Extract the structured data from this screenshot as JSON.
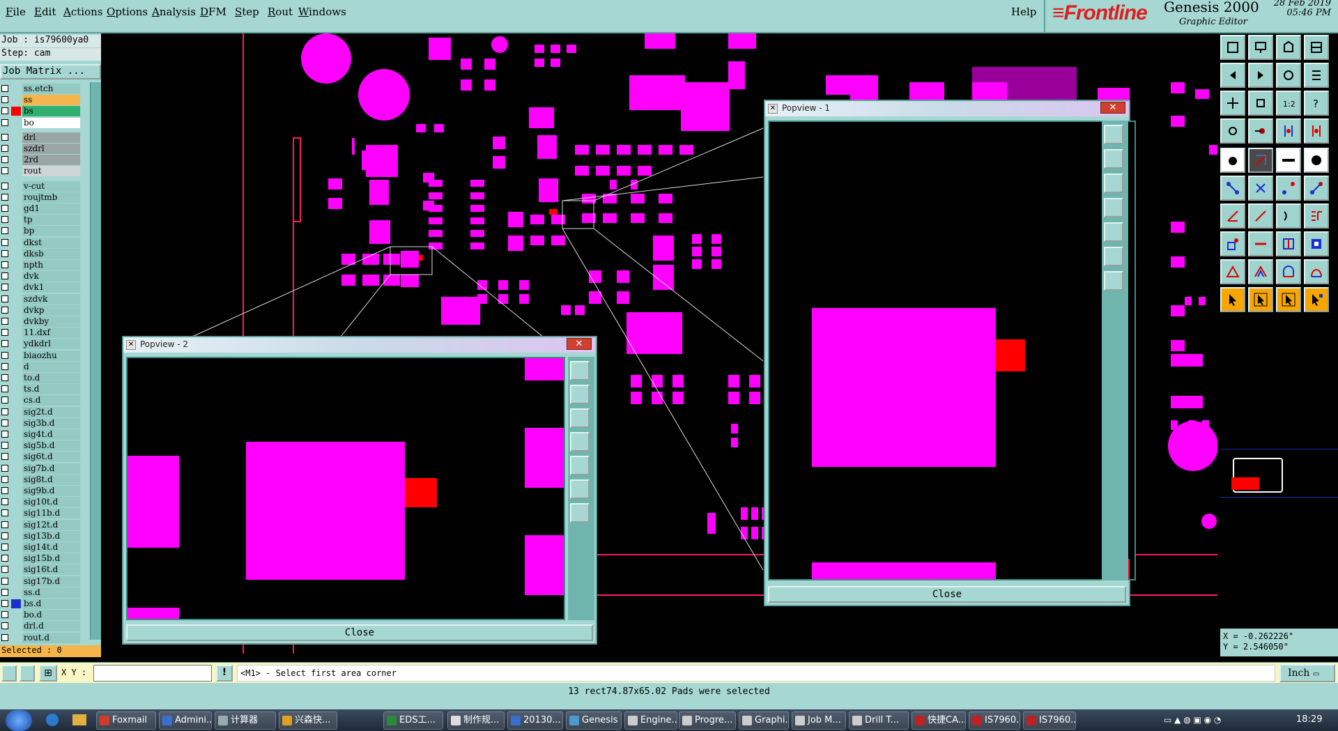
{
  "menu": [
    "File",
    "Edit",
    "Actions",
    "Options",
    "Analysis",
    "DFM",
    "Step",
    "Rout",
    "Windows"
  ],
  "help": "Help",
  "brand": {
    "logo": "Frontline",
    "title": "Genesis 2000",
    "subtitle": "Graphic Editor",
    "date": "28 Feb 2019",
    "time": "05:46 PM"
  },
  "job": {
    "job_line": "Job : is79600ya0",
    "step_line": "Step: cam",
    "job_matrix": "Job Matrix ..."
  },
  "layers": [
    {
      "name": "ss.etch",
      "color": "#94c9c4",
      "swatch": ""
    },
    {
      "name": "ss",
      "color": "#f5b54a",
      "swatch": ""
    },
    {
      "name": "bs",
      "color": "#2fb070",
      "swatch": "#ff0000"
    },
    {
      "name": "bo",
      "color": "#ffffff",
      "swatch": ""
    },
    {
      "name": "drl",
      "color": "#9aa6a4",
      "swatch": ""
    },
    {
      "name": "szdrl",
      "color": "#9aa6a4",
      "swatch": ""
    },
    {
      "name": "2rd",
      "color": "#9aa6a4",
      "swatch": ""
    },
    {
      "name": "rout",
      "color": "#d0d6d5",
      "swatch": ""
    },
    {
      "name": "v-cut",
      "color": "#94c9c4",
      "swatch": ""
    },
    {
      "name": "roujtmb",
      "color": "#94c9c4",
      "swatch": ""
    },
    {
      "name": "gd1",
      "color": "#94c9c4",
      "swatch": ""
    },
    {
      "name": "tp",
      "color": "#94c9c4",
      "swatch": ""
    },
    {
      "name": "bp",
      "color": "#94c9c4",
      "swatch": ""
    },
    {
      "name": "dkst",
      "color": "#94c9c4",
      "swatch": ""
    },
    {
      "name": "dksb",
      "color": "#94c9c4",
      "swatch": ""
    },
    {
      "name": "npth",
      "color": "#94c9c4",
      "swatch": ""
    },
    {
      "name": "dvk",
      "color": "#94c9c4",
      "swatch": ""
    },
    {
      "name": "dvk1",
      "color": "#94c9c4",
      "swatch": ""
    },
    {
      "name": "szdvk",
      "color": "#94c9c4",
      "swatch": ""
    },
    {
      "name": "dvkp",
      "color": "#94c9c4",
      "swatch": ""
    },
    {
      "name": "dvkby",
      "color": "#94c9c4",
      "swatch": ""
    },
    {
      "name": "11.dxf",
      "color": "#94c9c4",
      "swatch": ""
    },
    {
      "name": "ydkdrl",
      "color": "#94c9c4",
      "swatch": ""
    },
    {
      "name": "biaozhu",
      "color": "#94c9c4",
      "swatch": ""
    },
    {
      "name": "d",
      "color": "#94c9c4",
      "swatch": ""
    },
    {
      "name": "to.d",
      "color": "#94c9c4",
      "swatch": ""
    },
    {
      "name": "ts.d",
      "color": "#94c9c4",
      "swatch": ""
    },
    {
      "name": "cs.d",
      "color": "#94c9c4",
      "swatch": ""
    },
    {
      "name": "sig2t.d",
      "color": "#94c9c4",
      "swatch": ""
    },
    {
      "name": "sig3b.d",
      "color": "#94c9c4",
      "swatch": ""
    },
    {
      "name": "sig4t.d",
      "color": "#94c9c4",
      "swatch": ""
    },
    {
      "name": "sig5b.d",
      "color": "#94c9c4",
      "swatch": ""
    },
    {
      "name": "sig6t.d",
      "color": "#94c9c4",
      "swatch": ""
    },
    {
      "name": "sig7b.d",
      "color": "#94c9c4",
      "swatch": ""
    },
    {
      "name": "sig8t.d",
      "color": "#94c9c4",
      "swatch": ""
    },
    {
      "name": "sig9b.d",
      "color": "#94c9c4",
      "swatch": ""
    },
    {
      "name": "sig10t.d",
      "color": "#94c9c4",
      "swatch": ""
    },
    {
      "name": "sig11b.d",
      "color": "#94c9c4",
      "swatch": ""
    },
    {
      "name": "sig12t.d",
      "color": "#94c9c4",
      "swatch": ""
    },
    {
      "name": "sig13b.d",
      "color": "#94c9c4",
      "swatch": ""
    },
    {
      "name": "sig14t.d",
      "color": "#94c9c4",
      "swatch": ""
    },
    {
      "name": "sig15b.d",
      "color": "#94c9c4",
      "swatch": ""
    },
    {
      "name": "sig16t.d",
      "color": "#94c9c4",
      "swatch": ""
    },
    {
      "name": "sig17b.d",
      "color": "#94c9c4",
      "swatch": ""
    },
    {
      "name": "ss.d",
      "color": "#94c9c4",
      "swatch": ""
    },
    {
      "name": "bs.d",
      "color": "#94c9c4",
      "swatch": "#1a2fd0"
    },
    {
      "name": "bo.d",
      "color": "#94c9c4",
      "swatch": ""
    },
    {
      "name": "drl.d",
      "color": "#94c9c4",
      "swatch": ""
    },
    {
      "name": "rout.d",
      "color": "#94c9c4",
      "swatch": ""
    }
  ],
  "selected": "Selected : 0",
  "popview1": {
    "title": "Popview - 1",
    "close_label": "Close"
  },
  "popview2": {
    "title": "Popview - 2",
    "close_label": "Close"
  },
  "coords": {
    "x": "X = -0.262226\"",
    "y": "Y = 2.546050\""
  },
  "units": "Inch",
  "cmd": {
    "xy_label": "X Y :",
    "input_value": "",
    "prompt": "<M1> - Select first area corner"
  },
  "status": "13 rect74.87x65.02 Pads were selected",
  "taskbar": [
    {
      "label": "Foxmail",
      "color": "#d23a2a"
    },
    {
      "label": "Admini...",
      "color": "#3a6fd0"
    },
    {
      "label": "计算器",
      "color": "#9aa"
    },
    {
      "label": "兴森快...",
      "color": "#e0a020"
    },
    {
      "label": "EDS工...",
      "color": "#2a8a3a"
    },
    {
      "label": "制作规...",
      "color": "#ddd"
    },
    {
      "label": "20130...",
      "color": "#3a6fd0"
    },
    {
      "label": "Genesis",
      "color": "#4a9ad0"
    },
    {
      "label": "Engine...",
      "color": "#ccc"
    },
    {
      "label": "Progre...",
      "color": "#ccc"
    },
    {
      "label": "Graphi...",
      "color": "#ccc"
    },
    {
      "label": "Job M...",
      "color": "#ccc"
    },
    {
      "label": "Drill T...",
      "color": "#ccc"
    },
    {
      "label": "快捷CA...",
      "color": "#c02020"
    },
    {
      "label": "IS7960...",
      "color": "#c02020"
    },
    {
      "label": "IS7960...",
      "color": "#c02020"
    }
  ],
  "clock": "18:29"
}
